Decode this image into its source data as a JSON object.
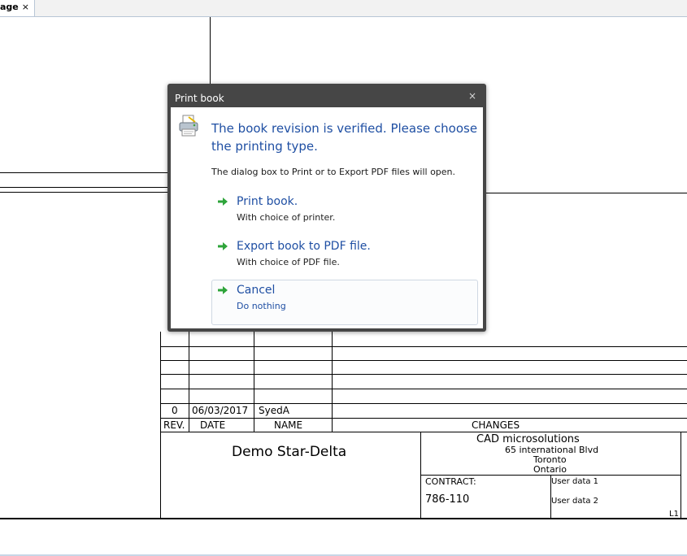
{
  "tab": {
    "label": "age",
    "close": "×"
  },
  "title_block": {
    "revision_rows": [
      {
        "rev": "0",
        "date": "06/03/2017",
        "name": "SyedA",
        "changes": ""
      }
    ],
    "headers": {
      "rev": "REV.",
      "date": "DATE",
      "name": "NAME",
      "changes": "CHANGES"
    },
    "project_title": "Demo Star-Delta",
    "company": {
      "name": "CAD microsolutions",
      "address1": "65 international Blvd",
      "city": "Toronto",
      "province": "Ontario"
    },
    "contract_label": "CONTRACT:",
    "contract_value": "786-110",
    "user_data_1": "User data 1",
    "user_data_2": "User data 2",
    "sheet": "L1"
  },
  "dialog": {
    "title": "Print book",
    "close": "×",
    "instruction": "The book revision is verified. Please choose the printing type.",
    "content": "The dialog box to Print or to Export PDF files will open.",
    "commands": [
      {
        "label": "Print book.",
        "note": "With choice of printer."
      },
      {
        "label": "Export book to PDF file.",
        "note": "With choice of PDF file."
      },
      {
        "label": "Cancel",
        "note": "Do nothing"
      }
    ]
  }
}
